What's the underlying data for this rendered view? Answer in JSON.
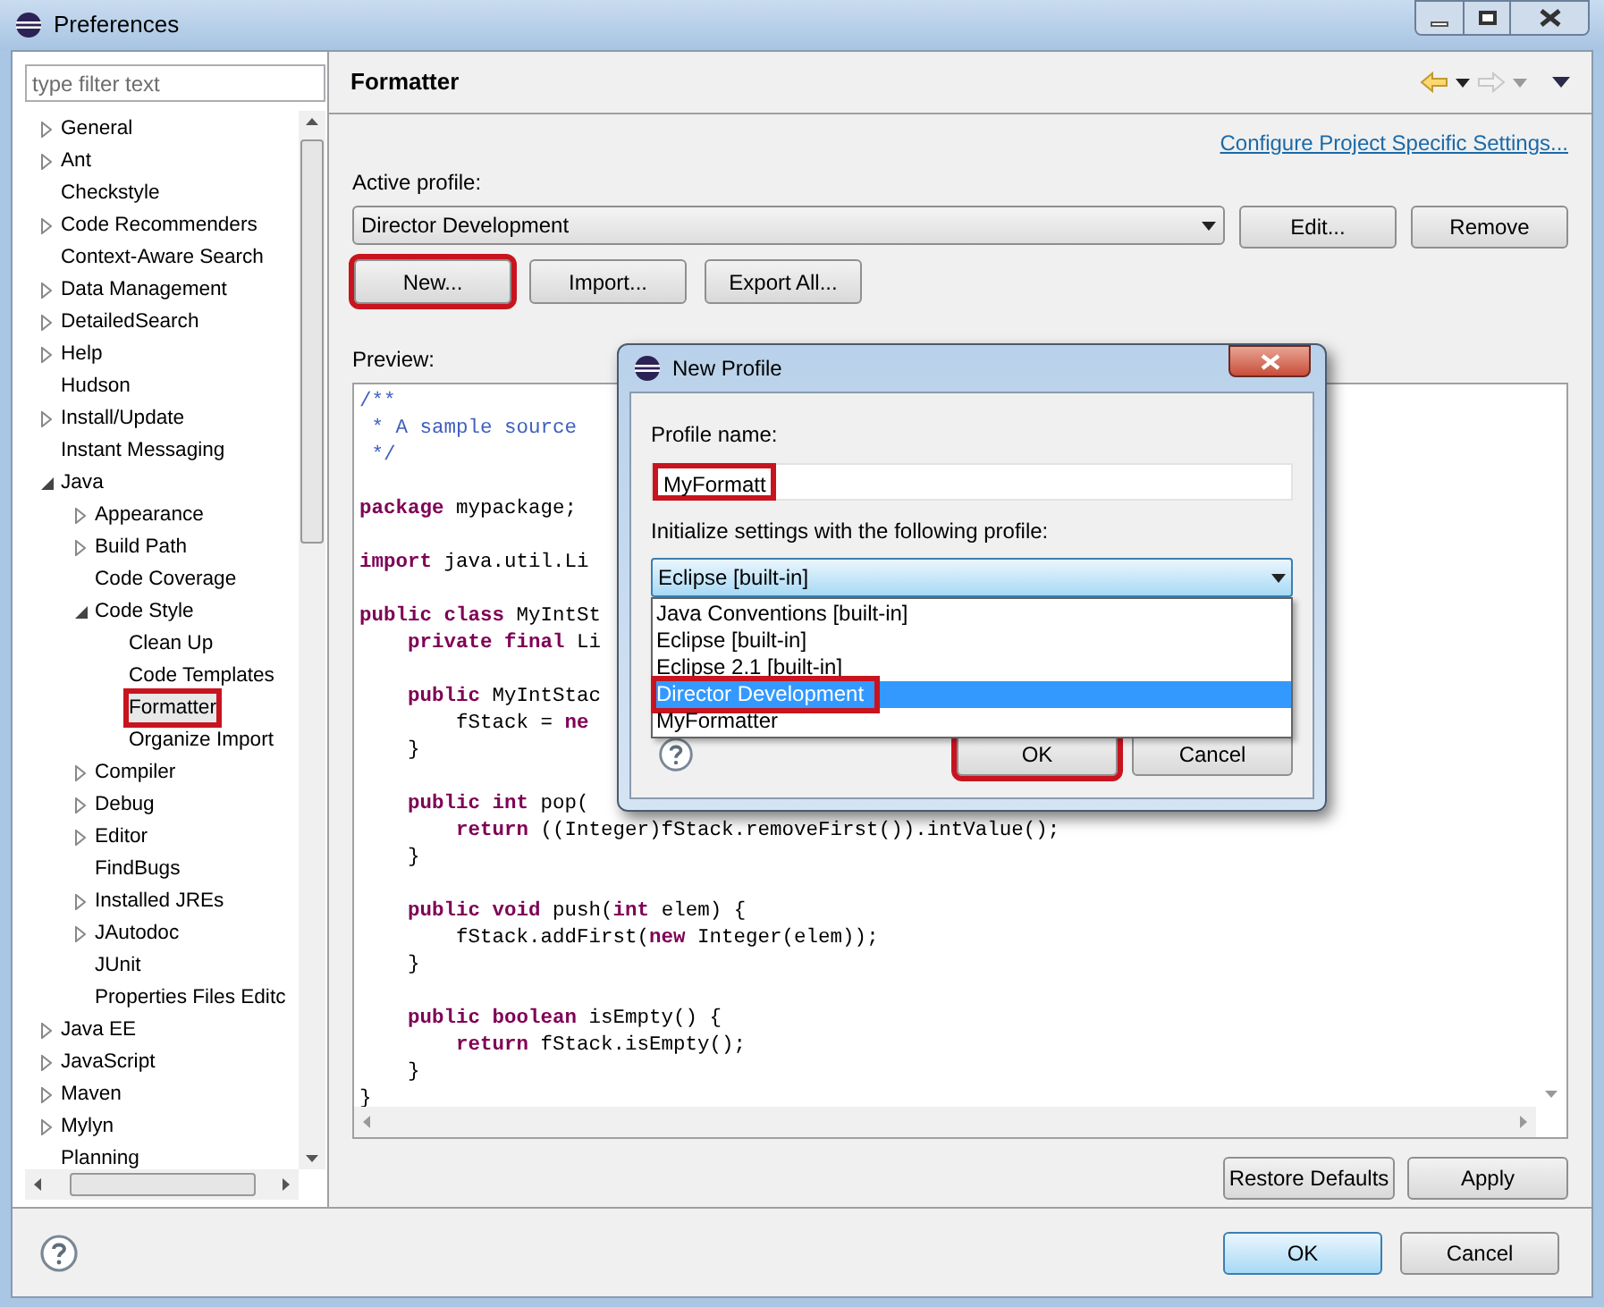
{
  "window": {
    "title": "Preferences"
  },
  "filter": {
    "placeholder": "type filter text"
  },
  "tree": [
    {
      "label": "General",
      "kind": "branch",
      "expanded": false,
      "selected": false
    },
    {
      "label": "Ant",
      "kind": "branch",
      "expanded": false,
      "selected": false
    },
    {
      "label": "Checkstyle",
      "kind": "leaf",
      "selected": false
    },
    {
      "label": "Code Recommenders",
      "kind": "branch",
      "expanded": false,
      "selected": false
    },
    {
      "label": "Context-Aware Search",
      "kind": "leaf",
      "selected": false
    },
    {
      "label": "Data Management",
      "kind": "branch",
      "expanded": false,
      "selected": false
    },
    {
      "label": "DetailedSearch",
      "kind": "branch",
      "expanded": false,
      "selected": false
    },
    {
      "label": "Help",
      "kind": "branch",
      "expanded": false,
      "selected": false
    },
    {
      "label": "Hudson",
      "kind": "leaf",
      "selected": false
    },
    {
      "label": "Install/Update",
      "kind": "branch",
      "expanded": false,
      "selected": false
    },
    {
      "label": "Instant Messaging",
      "kind": "leaf",
      "selected": false
    },
    {
      "label": "Java",
      "kind": "branch",
      "expanded": true,
      "selected": false,
      "children": [
        {
          "label": "Appearance",
          "kind": "branch",
          "expanded": false,
          "selected": false
        },
        {
          "label": "Build Path",
          "kind": "branch",
          "expanded": false,
          "selected": false
        },
        {
          "label": "Code Coverage",
          "kind": "leaf",
          "selected": false
        },
        {
          "label": "Code Style",
          "kind": "branch",
          "expanded": true,
          "selected": false,
          "children": [
            {
              "label": "Clean Up",
              "kind": "leaf",
              "selected": false
            },
            {
              "label": "Code Templates",
              "kind": "leaf",
              "selected": false
            },
            {
              "label": "Formatter",
              "kind": "leaf",
              "selected": true
            },
            {
              "label": "Organize Import",
              "kind": "leaf",
              "selected": false
            }
          ]
        },
        {
          "label": "Compiler",
          "kind": "branch",
          "expanded": false,
          "selected": false
        },
        {
          "label": "Debug",
          "kind": "branch",
          "expanded": false,
          "selected": false
        },
        {
          "label": "Editor",
          "kind": "branch",
          "expanded": false,
          "selected": false
        },
        {
          "label": "FindBugs",
          "kind": "leaf",
          "selected": false
        },
        {
          "label": "Installed JREs",
          "kind": "branch",
          "expanded": false,
          "selected": false
        },
        {
          "label": "JAutodoc",
          "kind": "branch",
          "expanded": false,
          "selected": false
        },
        {
          "label": "JUnit",
          "kind": "leaf",
          "selected": false
        },
        {
          "label": "Properties Files Editc",
          "kind": "leaf",
          "selected": false
        }
      ]
    },
    {
      "label": "Java EE",
      "kind": "branch",
      "expanded": false,
      "selected": false
    },
    {
      "label": "JavaScript",
      "kind": "branch",
      "expanded": false,
      "selected": false
    },
    {
      "label": "Maven",
      "kind": "branch",
      "expanded": false,
      "selected": false
    },
    {
      "label": "Mylyn",
      "kind": "branch",
      "expanded": false,
      "selected": false
    },
    {
      "label": "Planning",
      "kind": "leaf",
      "selected": false
    }
  ],
  "page": {
    "title": "Formatter",
    "link": "Configure Project Specific Settings...",
    "active_profile_label": "Active profile:",
    "active_profile": "Director Development",
    "profile_buttons": [
      {
        "label": "Edit...",
        "annotated": false
      },
      {
        "label": "Remove",
        "annotated": false
      }
    ],
    "action_buttons": [
      {
        "label": "New...",
        "annotated": true
      },
      {
        "label": "Import...",
        "annotated": false
      },
      {
        "label": "Export All...",
        "annotated": false
      }
    ],
    "preview_label": "Preview:",
    "code_blocks": [
      [
        {
          "kind": "comment",
          "text": "/**"
        },
        {
          "kind": "comment",
          "text": " * A sample source"
        },
        {
          "kind": "comment",
          "text": " */"
        }
      ],
      [
        {
          "kind": "code",
          "text": "**package** mypackage;"
        }
      ],
      [
        {
          "kind": "code",
          "text": "**import** java.util.Li"
        }
      ],
      [
        {
          "kind": "code",
          "text": "**public class** MyIntSt"
        },
        {
          "kind": "code",
          "text": "    **private final** Li"
        }
      ],
      [
        {
          "kind": "code",
          "text": "    **public** MyIntStac"
        },
        {
          "kind": "code",
          "text": "        fStack = **ne**"
        },
        {
          "kind": "code",
          "text": "    }"
        }
      ],
      [
        {
          "kind": "code",
          "text": "    **public int** pop("
        },
        {
          "kind": "code",
          "text": "        **return** ((Integer)fStack.removeFirst()).intValue();"
        },
        {
          "kind": "code",
          "text": "    }"
        }
      ],
      [
        {
          "kind": "code",
          "text": "    **public void** push(**int** elem) {"
        },
        {
          "kind": "code",
          "text": "        fStack.addFirst(**new** Integer(elem));"
        },
        {
          "kind": "code",
          "text": "    }"
        }
      ],
      [
        {
          "kind": "code",
          "text": "    **public boolean** isEmpty() {"
        },
        {
          "kind": "code",
          "text": "        **return** fStack.isEmpty();"
        },
        {
          "kind": "code",
          "text": "    }"
        },
        {
          "kind": "code",
          "text": "}"
        }
      ]
    ],
    "bottom_buttons": [
      {
        "label": "Restore Defaults"
      },
      {
        "label": "Apply"
      }
    ]
  },
  "dialog": {
    "title": "New Profile",
    "name_label": "Profile name:",
    "name_value": "MyFormatt",
    "name_annotated": true,
    "init_label": "Initialize settings with the following profile:",
    "init_value": "Eclipse [built-in]",
    "options": [
      {
        "label": "Java Conventions [built-in]",
        "selected": false
      },
      {
        "label": "Eclipse [built-in]",
        "selected": false
      },
      {
        "label": "Eclipse 2.1 [built-in]",
        "selected": false
      },
      {
        "label": "Director Development",
        "selected": true
      },
      {
        "label": "MyFormatter",
        "selected": false
      }
    ],
    "buttons": [
      {
        "label": "OK",
        "annotated": true
      },
      {
        "label": "Cancel",
        "annotated": false
      }
    ]
  },
  "footer_buttons": [
    {
      "label": "OK",
      "default": true
    },
    {
      "label": "Cancel",
      "default": false
    }
  ]
}
